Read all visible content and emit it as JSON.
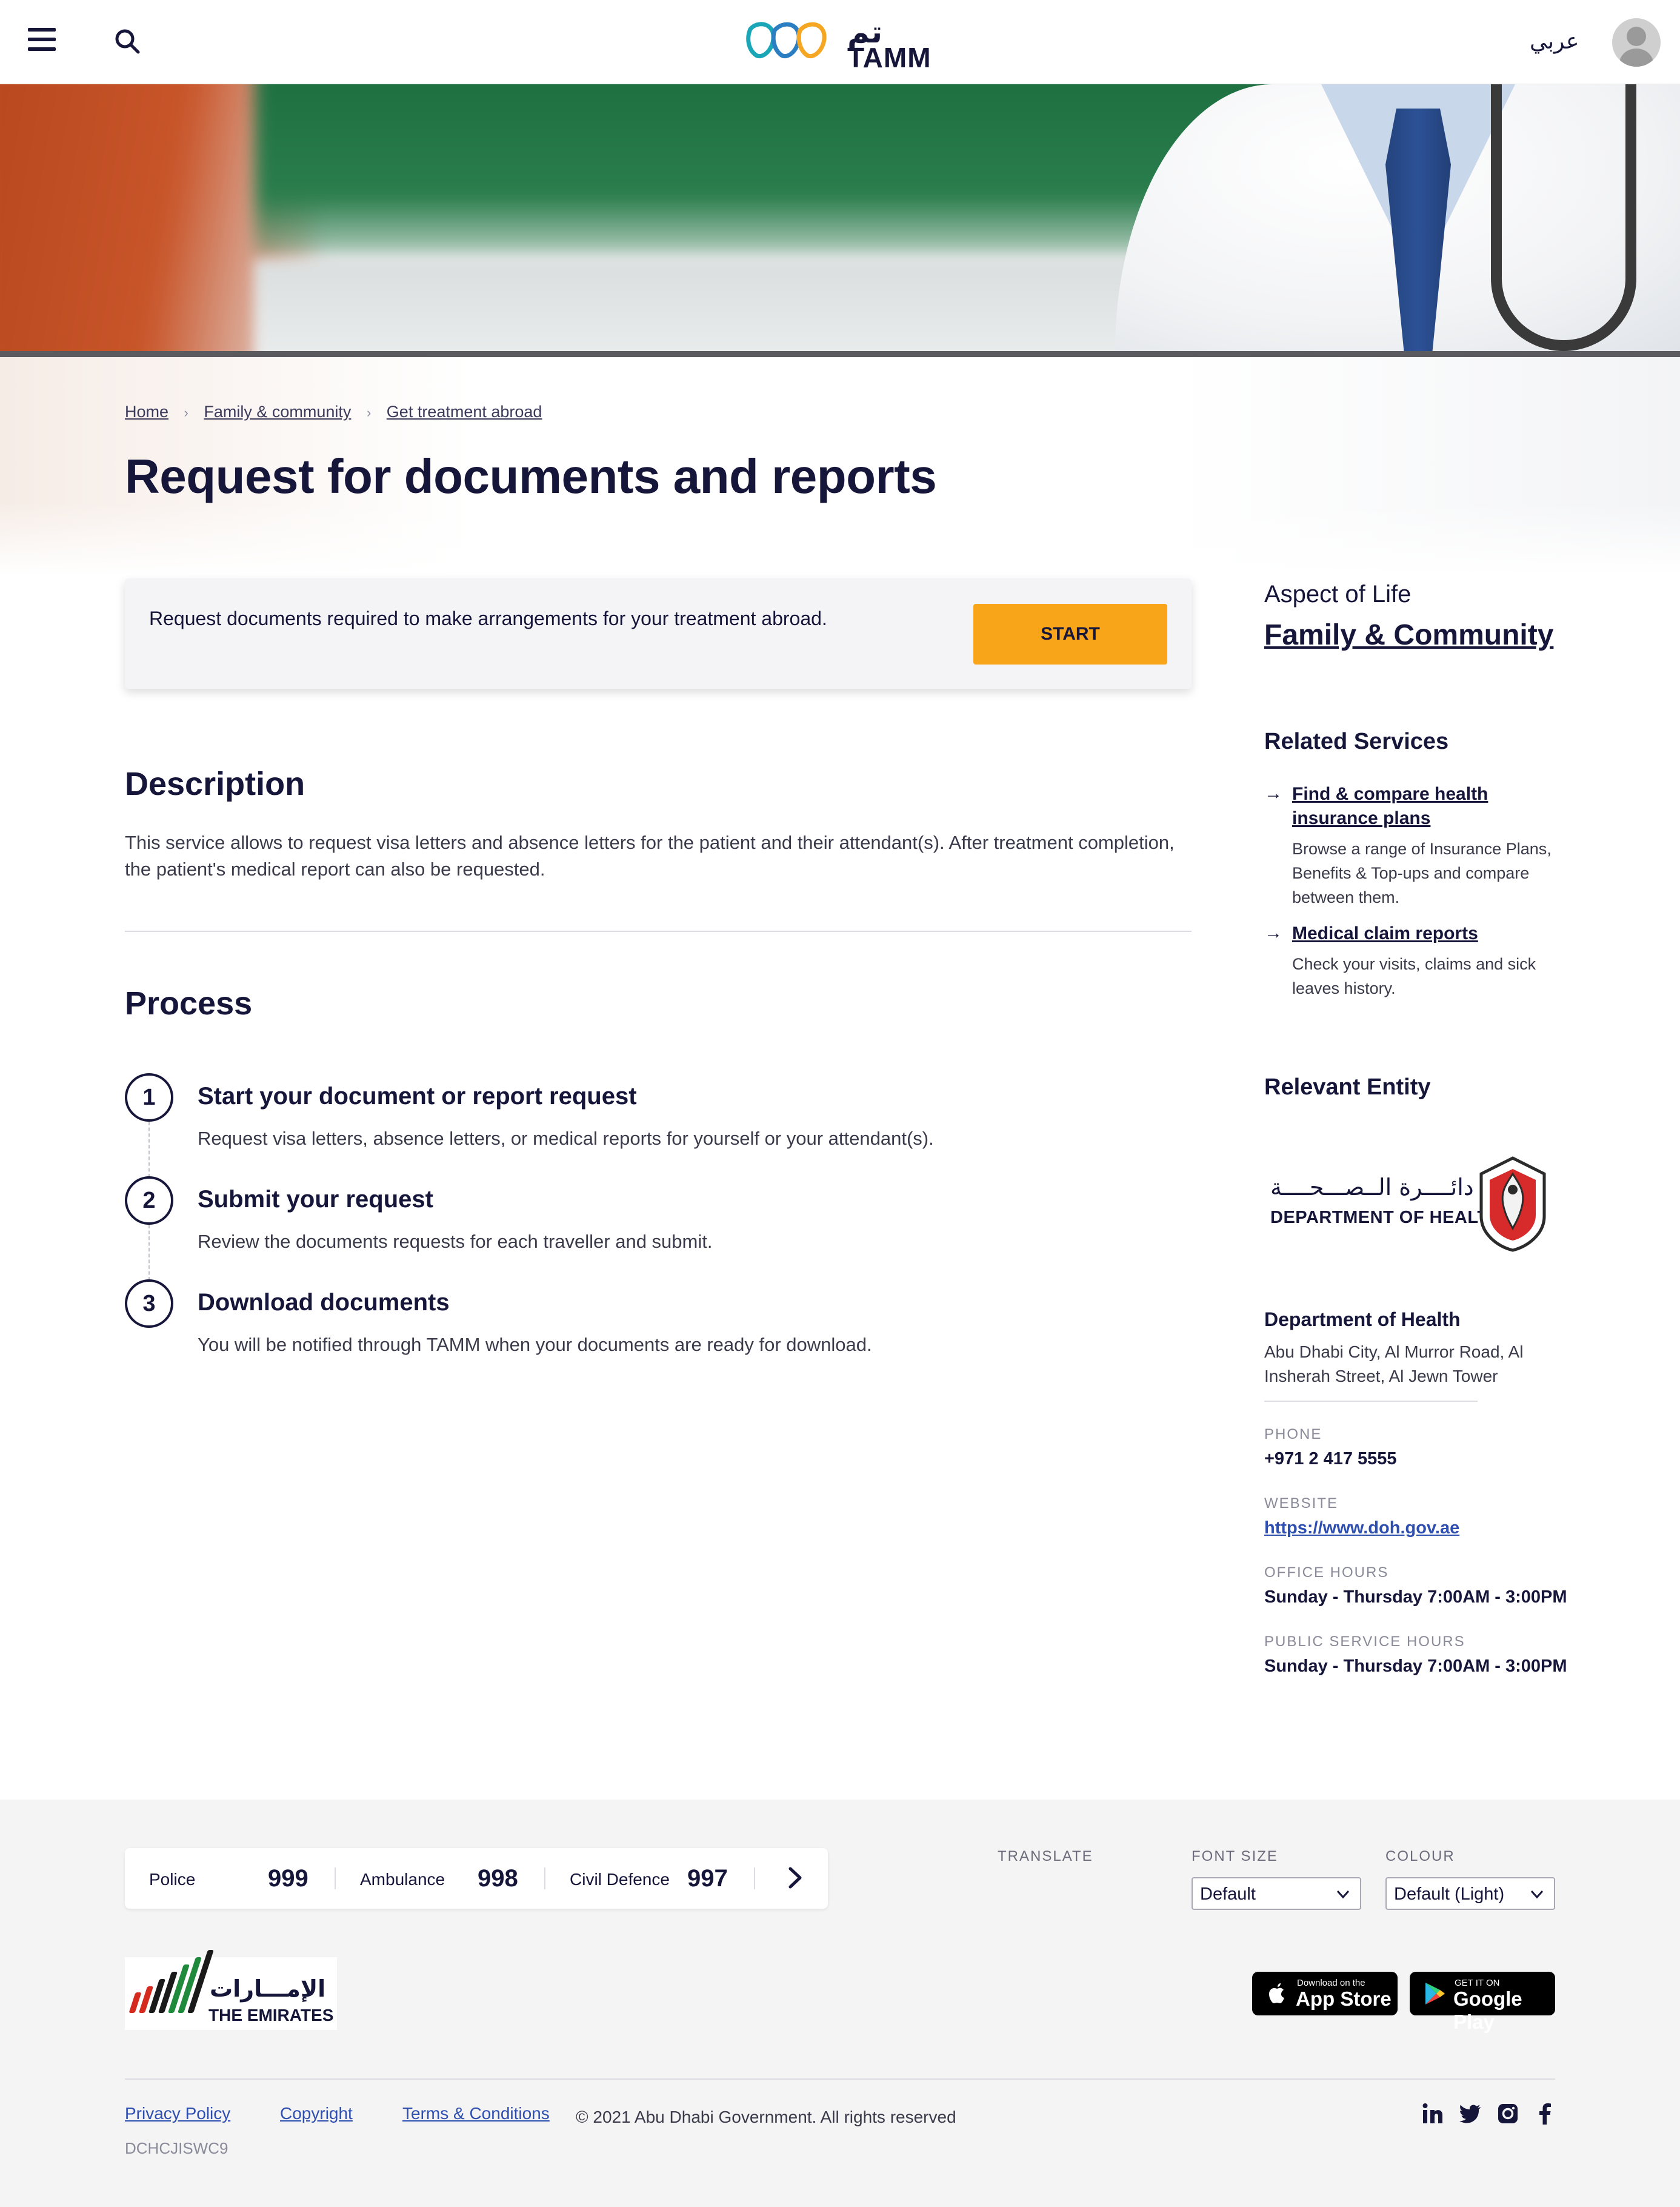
{
  "header": {
    "logo_text": "TAMM",
    "logo_arabic": "تم",
    "language_toggle": "عربي"
  },
  "breadcrumb": {
    "items": [
      "Home",
      "Family & community",
      "Get treatment abroad"
    ]
  },
  "page": {
    "title": "Request for documents and reports"
  },
  "start_card": {
    "text": "Request documents required to make arrangements for your treatment abroad.",
    "button_label": "START",
    "button_color": "#f9a51a"
  },
  "description": {
    "heading": "Description",
    "body": "This service allows to request visa letters and absence letters for the patient and their attendant(s). After treatment completion, the patient's medical report can also be requested."
  },
  "process": {
    "heading": "Process",
    "steps": [
      {
        "number": "1",
        "title": "Start your document or report request",
        "desc": "Request visa letters, absence letters, or medical reports for yourself or your attendant(s)."
      },
      {
        "number": "2",
        "title": "Submit your request",
        "desc": "Review the documents requests for each traveller and submit."
      },
      {
        "number": "3",
        "title": "Download documents",
        "desc": "You will be notified through TAMM when your documents are ready for download."
      }
    ]
  },
  "sidebar": {
    "aspect_label": "Aspect of Life",
    "aspect_link": "Family & Community",
    "related_heading": "Related Services",
    "related": [
      {
        "title": "Find & compare health insurance plans",
        "desc": "Browse a range of Insurance Plans, Benefits & Top-ups and compare between them."
      },
      {
        "title": "Medical claim reports",
        "desc": "Check your visits, claims and sick leaves history."
      }
    ],
    "entity_heading": "Relevant Entity",
    "entity_logo_en": "DEPARTMENT OF HEALTH",
    "entity_logo_ar": "دائــــرة الــصـــحــــة",
    "entity_name": "Department of Health",
    "entity_address": "Abu Dhabi City, Al Murror Road, Al Insherah Street, Al Jewn Tower",
    "phone_label": "PHONE",
    "phone": "+971 2 417 5555",
    "website_label": "WEBSITE",
    "website": "https://www.doh.gov.ae",
    "office_hours_label": "OFFICE HOURS",
    "office_hours": "Sunday - Thursday 7:00AM - 3:00PM",
    "public_hours_label": "PUBLIC SERVICE HOURS",
    "public_hours": "Sunday - Thursday 7:00AM - 3:00PM"
  },
  "footer": {
    "emergency": [
      {
        "label": "Police",
        "number": "999"
      },
      {
        "label": "Ambulance",
        "number": "998"
      },
      {
        "label": "Civil Defence",
        "number": "997"
      }
    ],
    "translate_label": "TRANSLATE",
    "font_size_label": "FONT SIZE",
    "font_size_value": "Default",
    "colour_label": "COLOUR",
    "colour_value": "Default (Light)",
    "emirates_en": "THE EMIRATES",
    "emirates_ar": "الإمـــارات",
    "app_store_small": "Download on the",
    "app_store_big": "App Store",
    "google_play_small": "GET IT ON",
    "google_play_big": "Google Play",
    "links": [
      "Privacy Policy",
      "Copyright",
      "Terms & Conditions"
    ],
    "copyright": "© 2021 Abu Dhabi Government. All rights reserved",
    "code": "DCHCJISWC9",
    "social_icons": [
      "linkedin-icon",
      "twitter-icon",
      "instagram-icon",
      "facebook-icon"
    ]
  }
}
